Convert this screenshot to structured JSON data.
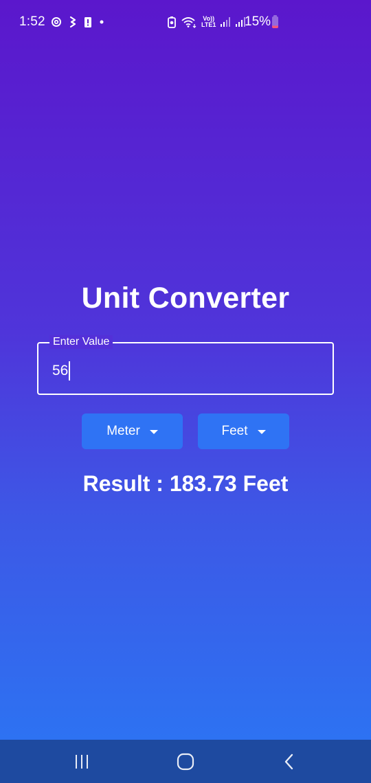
{
  "status_bar": {
    "time": "1:52",
    "battery_percent": "15%",
    "network_label_top": "Vo))",
    "network_label_bottom": "LTE1",
    "icons": [
      "threads-icon",
      "eazypay-icon",
      "alert-icon",
      "dot-icon",
      "battery-saver-icon",
      "wifi-icon",
      "volte-icon",
      "signal-icon",
      "signal-icon",
      "battery-icon"
    ]
  },
  "app": {
    "title": "Unit Converter",
    "input": {
      "label": "Enter Value",
      "value": "56"
    },
    "from_unit": {
      "selected": "Meter"
    },
    "to_unit": {
      "selected": "Feet"
    },
    "result": "Result : 183.73 Feet"
  },
  "nav_bar": {
    "buttons": [
      "recents-icon",
      "home-icon",
      "back-icon"
    ]
  },
  "colors": {
    "gradient_top": "#5b17cc",
    "gradient_bottom": "#2d72f2",
    "button_bg": "#2f73f4",
    "nav_bg": "#1e4aa0",
    "text": "#ffffff"
  }
}
